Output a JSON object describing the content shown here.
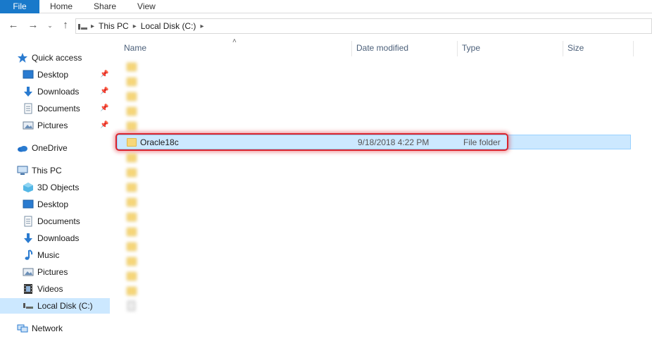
{
  "ribbon": {
    "tabs": [
      {
        "label": "File"
      },
      {
        "label": "Home"
      },
      {
        "label": "Share"
      },
      {
        "label": "View"
      }
    ]
  },
  "address": {
    "crumbs": [
      "This PC",
      "Local Disk (C:)"
    ]
  },
  "sidebar": {
    "quick_access": "Quick access",
    "qa_items": [
      {
        "label": "Desktop",
        "icon": "desktop-icon"
      },
      {
        "label": "Downloads",
        "icon": "downloads-icon"
      },
      {
        "label": "Documents",
        "icon": "documents-icon"
      },
      {
        "label": "Pictures",
        "icon": "pictures-icon"
      }
    ],
    "onedrive": "OneDrive",
    "this_pc": "This PC",
    "pc_items": [
      {
        "label": "3D Objects",
        "icon": "3d-objects-icon"
      },
      {
        "label": "Desktop",
        "icon": "desktop-icon"
      },
      {
        "label": "Documents",
        "icon": "documents-icon"
      },
      {
        "label": "Downloads",
        "icon": "downloads-icon"
      },
      {
        "label": "Music",
        "icon": "music-icon"
      },
      {
        "label": "Pictures",
        "icon": "pictures-icon"
      },
      {
        "label": "Videos",
        "icon": "videos-icon"
      },
      {
        "label": "Local Disk (C:)",
        "icon": "local-disk-icon"
      }
    ],
    "network": "Network"
  },
  "columns": {
    "name": "Name",
    "date": "Date modified",
    "type": "Type",
    "size": "Size"
  },
  "selected_row": {
    "name": "Oracle18c",
    "date": "9/18/2018 4:22 PM",
    "type": "File folder"
  },
  "colors": {
    "accent": "#1979ca",
    "selection": "#cce8ff",
    "highlight_border": "#d9232d"
  }
}
